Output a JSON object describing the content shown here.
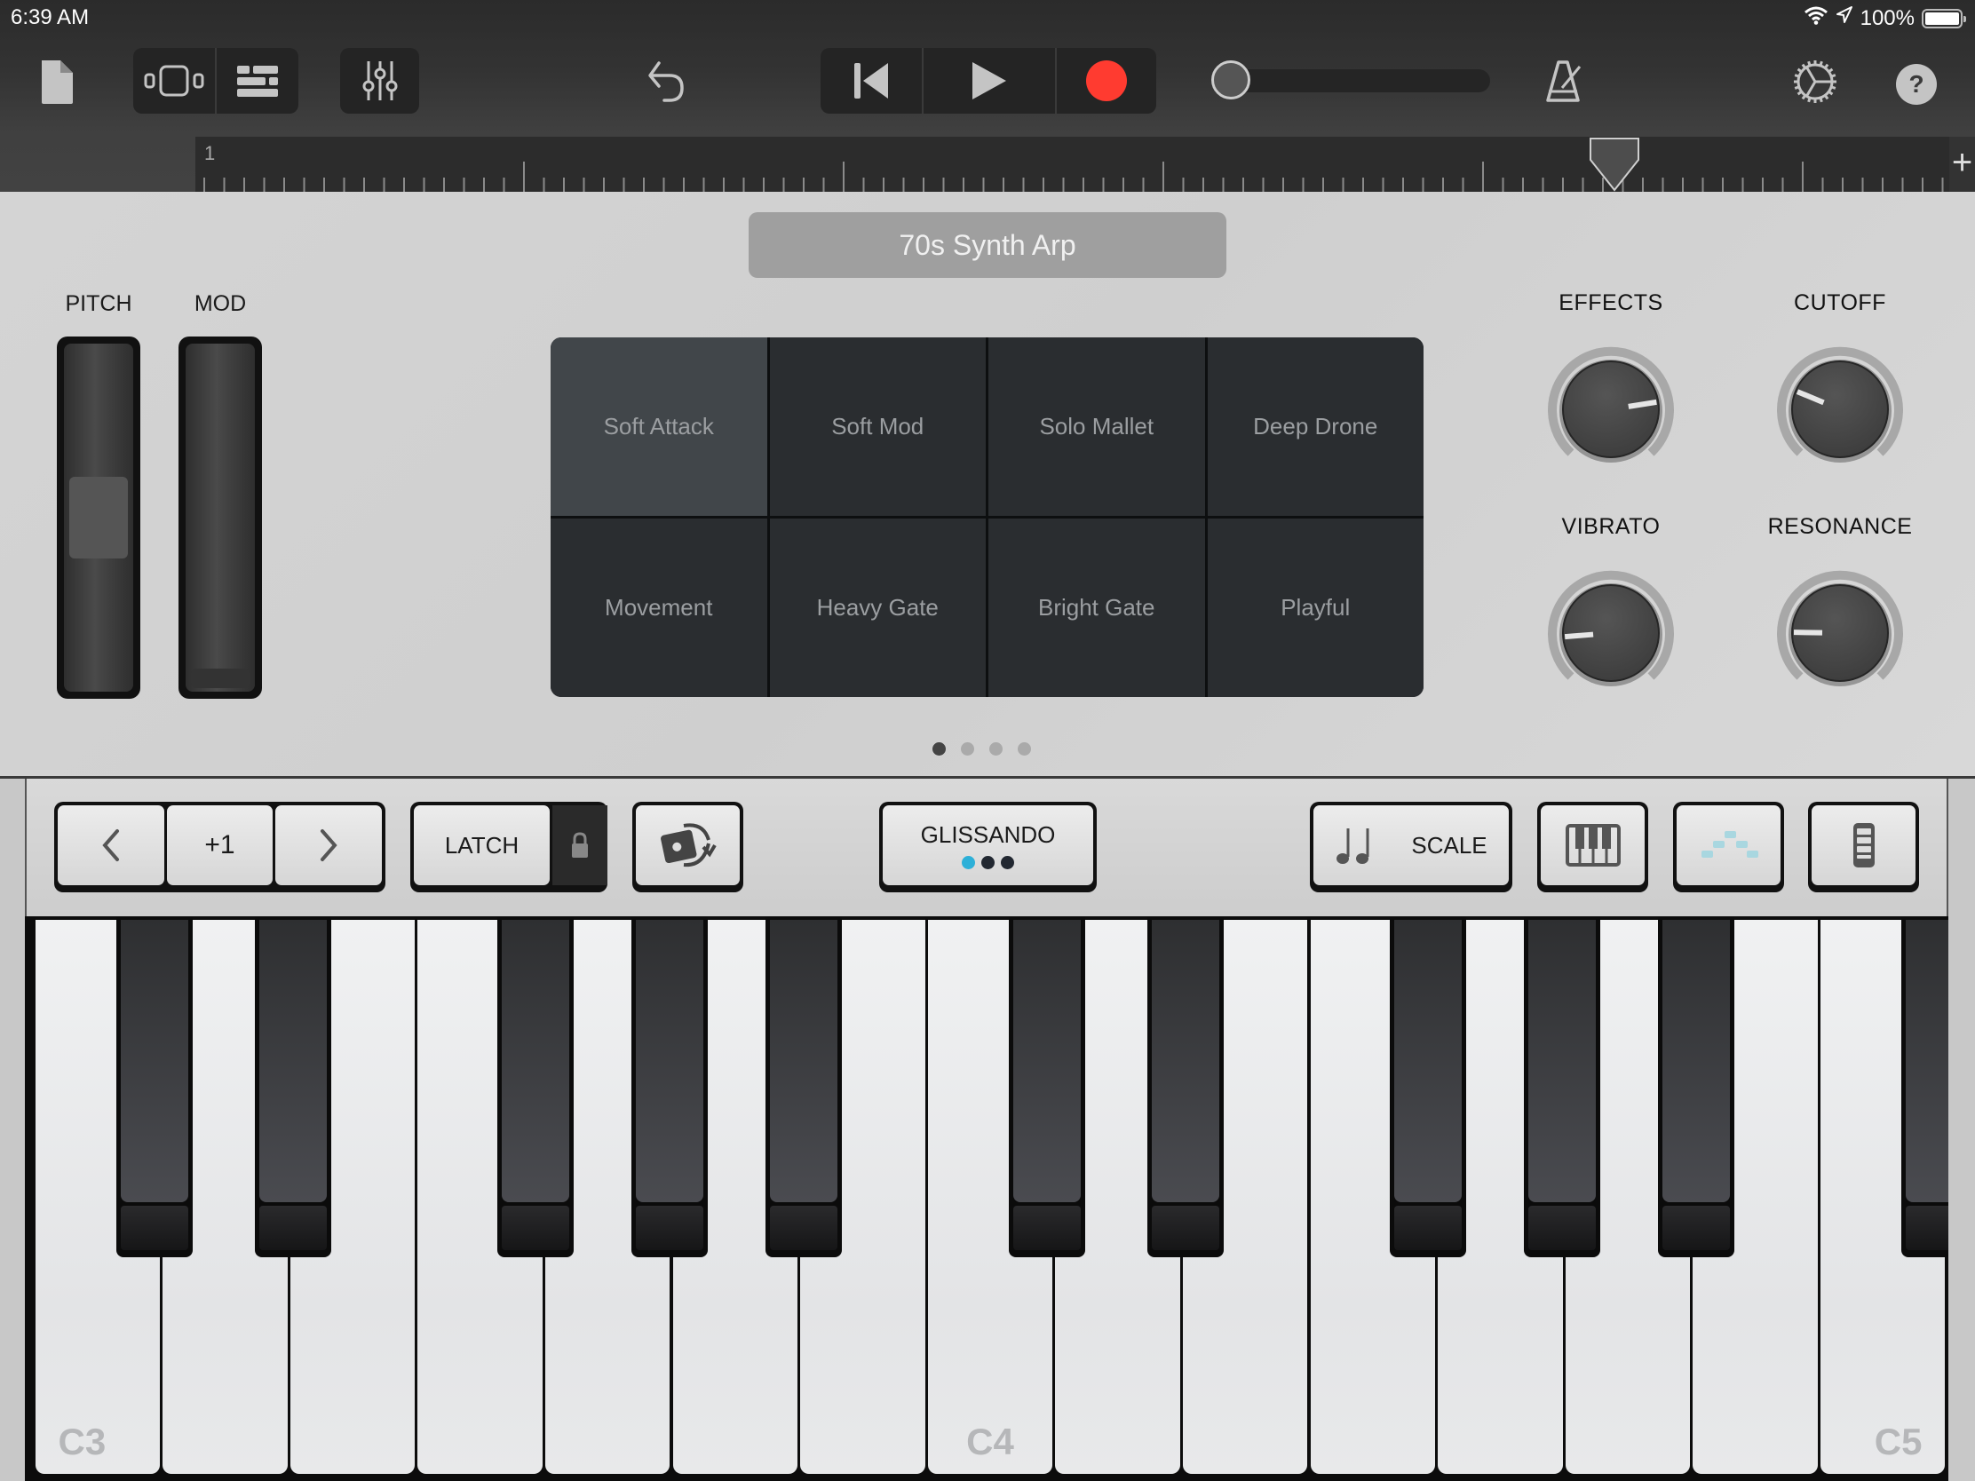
{
  "status_bar": {
    "time": "6:39 AM",
    "battery": "100%",
    "icons": [
      "wifi-icon",
      "location-icon",
      "battery-icon"
    ]
  },
  "toolbar": {
    "buttons": [
      {
        "name": "my-songs",
        "icon": "document-icon"
      },
      {
        "name": "instrument-view",
        "icon": "instrument-view-icon"
      },
      {
        "name": "tracks-view",
        "icon": "tracks-view-icon"
      },
      {
        "name": "track-controls",
        "icon": "mixer-icon"
      },
      {
        "name": "undo",
        "icon": "undo-icon"
      },
      {
        "name": "go-to-beginning",
        "icon": "skip-back-icon"
      },
      {
        "name": "play",
        "icon": "play-icon"
      },
      {
        "name": "record",
        "icon": "record-icon"
      },
      {
        "name": "metronome",
        "icon": "metronome-icon"
      },
      {
        "name": "settings",
        "icon": "gear-icon"
      },
      {
        "name": "help",
        "icon": "help-icon"
      }
    ],
    "master_volume": 0.0,
    "record_color": "#ff3b30"
  },
  "ruler": {
    "start_bar": "1",
    "add_section_label": "+"
  },
  "instrument": {
    "preset_name": "70s Synth Arp",
    "wheels": [
      {
        "label": "PITCH",
        "value": 0.5
      },
      {
        "label": "MOD",
        "value": 0.0
      }
    ],
    "pads": [
      {
        "label": "Soft Attack",
        "selected": true
      },
      {
        "label": "Soft Mod",
        "selected": false
      },
      {
        "label": "Solo Mallet",
        "selected": false
      },
      {
        "label": "Deep Drone",
        "selected": false
      },
      {
        "label": "Movement",
        "selected": false
      },
      {
        "label": "Heavy Gate",
        "selected": false
      },
      {
        "label": "Bright Gate",
        "selected": false
      },
      {
        "label": "Playful",
        "selected": false
      }
    ],
    "knobs": [
      {
        "label": "EFFECTS",
        "value": 0.8
      },
      {
        "label": "CUTOFF",
        "value": 0.25
      },
      {
        "label": "VIBRATO",
        "value": 0.15
      },
      {
        "label": "RESONANCE",
        "value": 0.17
      }
    ],
    "page_count": 4,
    "current_page": 1,
    "accent_color": "#2bb6d6"
  },
  "controls": {
    "octave_down": "<",
    "octave_value": "+1",
    "octave_up": ">",
    "latch": "LATCH",
    "glissando": "GLISSANDO",
    "glissando_mode": 1,
    "glissando_modes": 3,
    "scale": "SCALE"
  },
  "keyboard": {
    "labels": {
      "C3": "C3",
      "C4": "C4",
      "C5": "C5"
    },
    "white_keys": [
      "C3",
      "D3",
      "E3",
      "F3",
      "G3",
      "A3",
      "B3",
      "C4",
      "D4",
      "E4",
      "F4",
      "G4",
      "A4",
      "B4",
      "C5"
    ],
    "black_keys": [
      "C#3",
      "D#3",
      "F#3",
      "G#3",
      "A#3",
      "C#4",
      "D#4",
      "F#4",
      "G#4",
      "A#4",
      "C#5"
    ]
  }
}
